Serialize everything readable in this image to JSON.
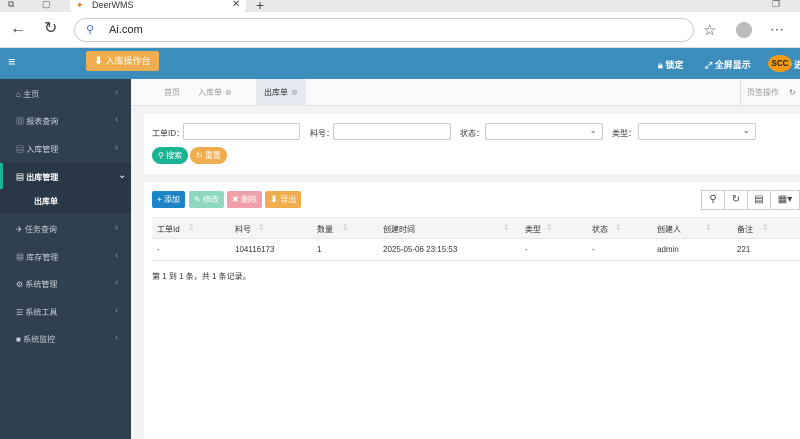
{
  "browser": {
    "tab_title": "DeerWMS",
    "url": "Ai.com"
  },
  "header": {
    "inbound_btn": "入库操作台",
    "lock": "锁定",
    "fullscreen": "全屏显示",
    "logo": "SCC",
    "user_partial": "进"
  },
  "sidebar": {
    "items": [
      {
        "label": "主页",
        "icon": "home-icon"
      },
      {
        "label": "报表查询",
        "icon": "chart-icon"
      },
      {
        "label": "入库管理",
        "icon": "inbound-icon"
      },
      {
        "label": "出库管理",
        "icon": "outbound-icon"
      },
      {
        "label": "任务查询",
        "icon": "plane-icon"
      },
      {
        "label": "库存管理",
        "icon": "stock-icon"
      },
      {
        "label": "系统管理",
        "icon": "gear-icon"
      },
      {
        "label": "系统工具",
        "icon": "list-icon"
      },
      {
        "label": "系统监控",
        "icon": "video-icon"
      }
    ],
    "sub_item": "出库单"
  },
  "page_tabs": {
    "home": "首页",
    "inbound": "入库单",
    "outbound": "出库单",
    "ops": "页签操作"
  },
  "filters": {
    "order_id_label": "工单ID：",
    "material_label": "料号：",
    "status_label": "状态：",
    "type_label": "类型：",
    "search_btn": "搜索",
    "reset_btn": "重置"
  },
  "toolbar": {
    "add": "添加",
    "edit": "修改",
    "delete": "删除",
    "export": "导出"
  },
  "table": {
    "columns": [
      "工单Id",
      "料号",
      "数量",
      "创建时间",
      "类型",
      "状态",
      "创建人",
      "备注"
    ],
    "rows": [
      [
        "-",
        "104116173",
        "1",
        "2025-05-06 23:15:53",
        "-",
        "-",
        "admin",
        "221"
      ]
    ],
    "summary": "第 1 到 1 条，共 1 条记录。"
  },
  "colors": {
    "header": "#3c8dbc",
    "sidebar": "#2f4050",
    "add": "#1c84c6",
    "edit": "#8fd9c0",
    "delete": "#f0a0a8",
    "export": "#f0ad4e",
    "search": "#1ab394",
    "reset": "#f0ad4e"
  }
}
